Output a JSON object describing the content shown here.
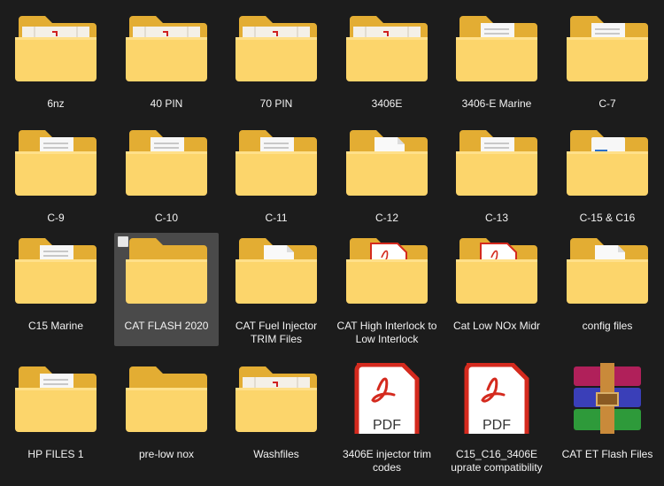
{
  "items": [
    {
      "label": "6nz",
      "icon": "folder-redmark-icon"
    },
    {
      "label": "40 PIN",
      "icon": "folder-redmark-icon"
    },
    {
      "label": "70 PIN",
      "icon": "folder-redmark-icon"
    },
    {
      "label": "3406E",
      "icon": "folder-redmark-icon"
    },
    {
      "label": "3406-E Marine",
      "icon": "folder-docs-icon"
    },
    {
      "label": "C-7",
      "icon": "folder-docs-icon"
    },
    {
      "label": "C-9",
      "icon": "folder-docs-icon"
    },
    {
      "label": "C-10",
      "icon": "folder-docs-icon"
    },
    {
      "label": "C-11",
      "icon": "folder-docs-icon"
    },
    {
      "label": "C-12",
      "icon": "folder-page-icon"
    },
    {
      "label": "C-13",
      "icon": "folder-docs-icon"
    },
    {
      "label": "C-15 & C16",
      "icon": "folder-image-icon"
    },
    {
      "label": "C15 Marine",
      "icon": "folder-docs-icon"
    },
    {
      "label": "CAT FLASH 2020",
      "icon": "folder-empty-icon",
      "selected": true
    },
    {
      "label": "CAT Fuel Injector TRIM Files",
      "icon": "folder-page-icon"
    },
    {
      "label": "CAT High Interlock to Low Interlock",
      "icon": "folder-pdf-icon"
    },
    {
      "label": "Cat Low NOx Midr",
      "icon": "folder-pdf-icon"
    },
    {
      "label": "config files",
      "icon": "folder-page-icon"
    },
    {
      "label": "HP FILES 1",
      "icon": "folder-docs-icon"
    },
    {
      "label": "pre-low nox",
      "icon": "folder-empty-icon"
    },
    {
      "label": "Washfiles",
      "icon": "folder-redmark-icon"
    },
    {
      "label": "3406E injector trim codes",
      "icon": "pdf-file-icon",
      "badge": "PDF"
    },
    {
      "label": "C15_C16_3406E uprate compatibility",
      "icon": "pdf-file-icon",
      "badge": "PDF"
    },
    {
      "label": "CAT ET Flash Files",
      "icon": "rar-archive-icon"
    }
  ],
  "colors": {
    "background": "#1c1c1c",
    "folder_back": "#e6b33a",
    "folder_front": "#fbd56a",
    "selection": "#4a4a4a",
    "pdf_red": "#d42a1e"
  }
}
